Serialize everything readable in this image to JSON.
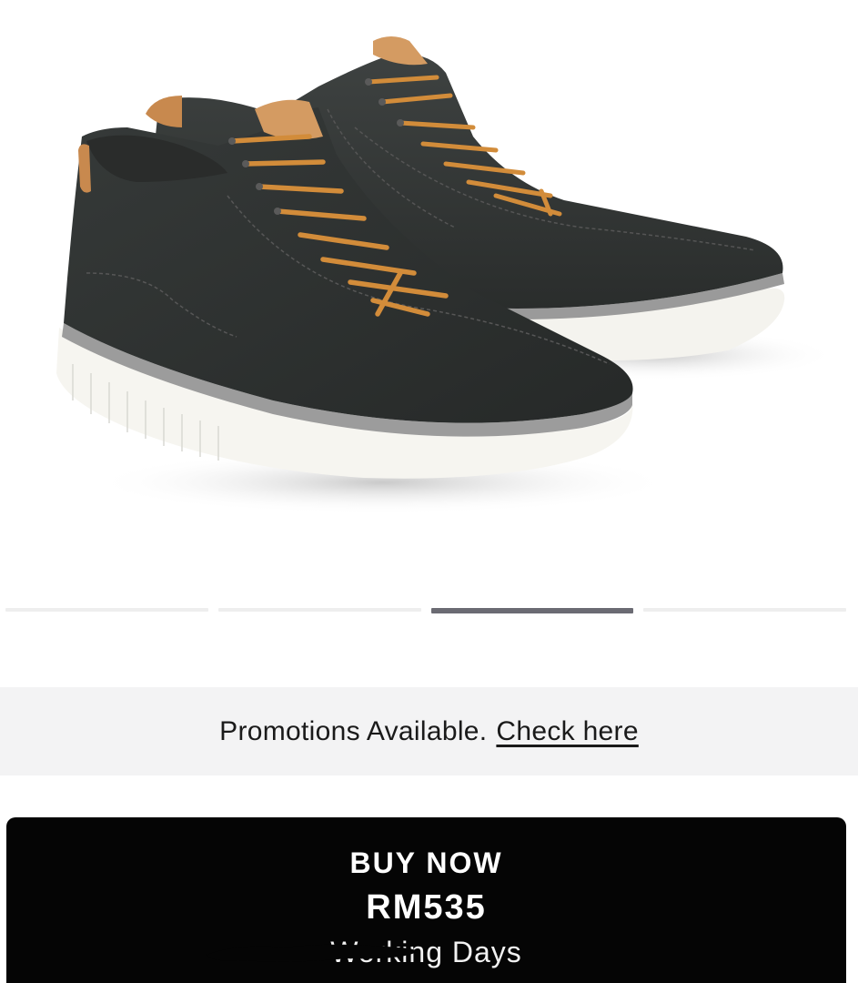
{
  "product": {
    "image_alt": "Timberland black nubuck chukka sneakers with tan laces"
  },
  "carousel": {
    "count": 4,
    "active_index": 2
  },
  "promo": {
    "text": "Promotions Available.",
    "link": "Check here"
  },
  "buy": {
    "label": "BUY NOW",
    "price": "RM535",
    "delivery": "Working Days"
  },
  "colors": {
    "button_bg": "#050505",
    "promo_bg": "#f3f3f4",
    "carousel_active": "#6b6b73",
    "carousel_inactive": "#eeeeee"
  }
}
